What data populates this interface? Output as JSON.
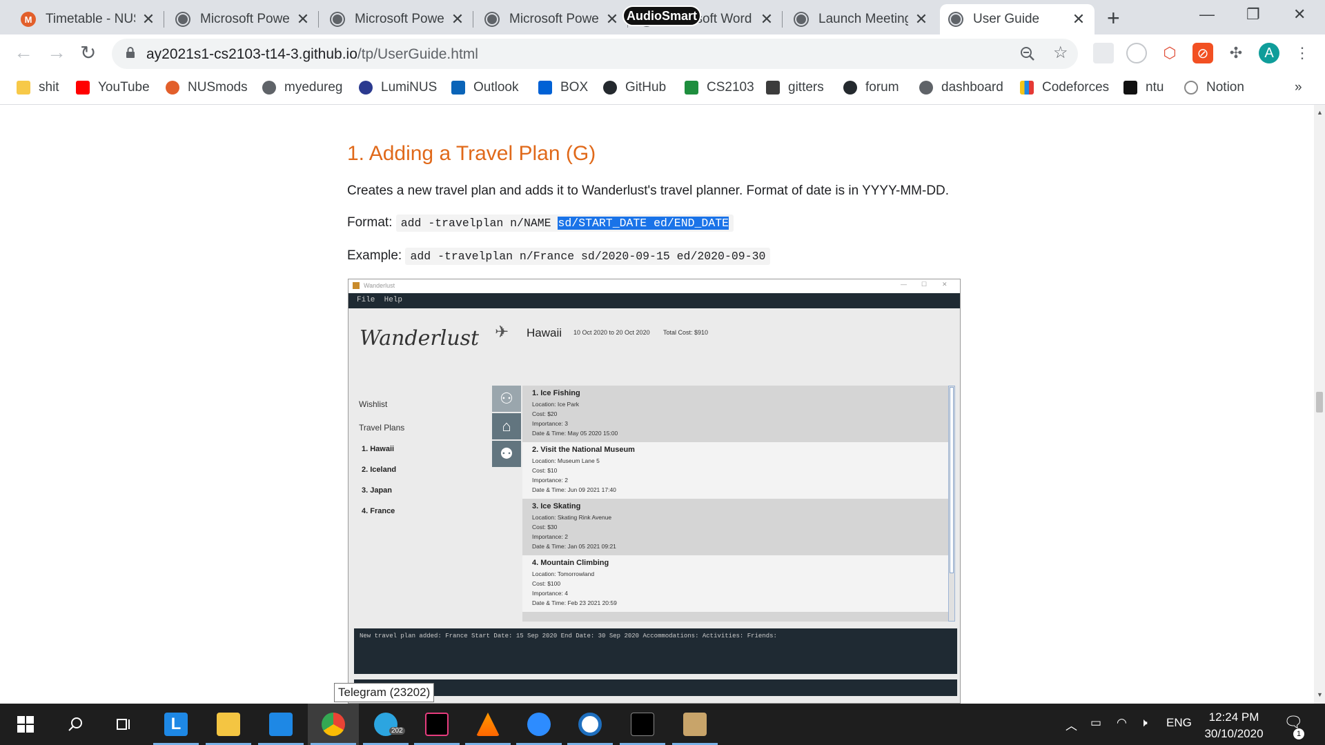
{
  "browser": {
    "tabs": [
      {
        "title": "Timetable - NUSMods",
        "favicon": "nusmods-icon"
      },
      {
        "title": "Microsoft PowerPoint",
        "favicon": "globe-icon"
      },
      {
        "title": "Microsoft PowerPoint",
        "favicon": "globe-icon"
      },
      {
        "title": "Microsoft PowerPoint",
        "favicon": "globe-icon"
      },
      {
        "title": "Microsoft Word",
        "favicon": "globe-icon"
      },
      {
        "title": "Launch Meeting",
        "favicon": "globe-icon"
      },
      {
        "title": "User Guide",
        "favicon": "globe-icon",
        "active": true
      }
    ],
    "overlay_badge": "AudioSmart",
    "url_host": "ay2021s1-cs2103-t14-3.github.io",
    "url_path": "/tp/UserGuide.html",
    "profile_initial": "A",
    "bookmarks": [
      "shit",
      "YouTube",
      "NUSmods",
      "myedureg",
      "LumiNUS",
      "Outlook",
      "BOX",
      "GitHub",
      "CS2103",
      "gitters",
      "forum",
      "dashboard",
      "Codeforces",
      "ntu",
      "Notion"
    ],
    "bookmarks_overflow": "»"
  },
  "doc": {
    "heading": "1. Adding a Travel Plan (G)",
    "description": "Creates a new travel plan and adds it to Wanderlust's travel planner. Format of date is in YYYY-MM-DD.",
    "format_label": "Format:",
    "format_code_plain": "add -travelplan n/NAME ",
    "format_code_selected": "sd/START_DATE ed/END_DATE",
    "example_label": "Example:",
    "example_code": "add -travelplan n/France sd/2020-09-15 ed/2020-09-30"
  },
  "app": {
    "window_title": "Wanderlust",
    "menu_file": "File",
    "menu_help": "Help",
    "logo": "Wanderlust",
    "plan_name": "Hawaii",
    "plan_dates": "10 Oct 2020 to 20 Oct 2020",
    "plan_cost": "Total Cost: $910",
    "nav_wishlist": "Wishlist",
    "nav_travelplans": "Travel Plans",
    "plans": [
      "1. Hawaii",
      "2. Iceland",
      "3. Japan",
      "4. France"
    ],
    "activities": [
      {
        "name": "1.  Ice Fishing",
        "location": "Location: Ice Park",
        "cost": "Cost: $20",
        "importance": "Importance: 3",
        "datetime": "Date & Time: May 05 2020 15:00"
      },
      {
        "name": "2.  Visit the National Museum",
        "location": "Location: Museum Lane 5",
        "cost": "Cost: $10",
        "importance": "Importance: 2",
        "datetime": "Date & Time: Jun 09 2021 17:40"
      },
      {
        "name": "3.  Ice Skating",
        "location": "Location: Skating Rink Avenue",
        "cost": "Cost: $30",
        "importance": "Importance: 2",
        "datetime": "Date & Time: Jan 05 2021 09:21"
      },
      {
        "name": "4.  Mountain Climbing",
        "location": "Location: Tomorrowland",
        "cost": "Cost: $100",
        "importance": "Importance: 4",
        "datetime": "Date & Time: Feb 23 2021 20:59"
      }
    ],
    "result": "New travel plan added: France Start Date: 15 Sep 2020 End Date: 30 Sep 2020 Accommodations:  Activities:  Friends:"
  },
  "tooltip": "Telegram (23202)",
  "taskbar": {
    "language": "ENG",
    "time": "12:24 PM",
    "date": "30/10/2020",
    "notification_count": "1",
    "telegram_badge": "202"
  },
  "colors": {
    "heading_orange": "#e0691a",
    "selection_blue": "#1a73e8",
    "app_dark": "#1f2a33"
  }
}
